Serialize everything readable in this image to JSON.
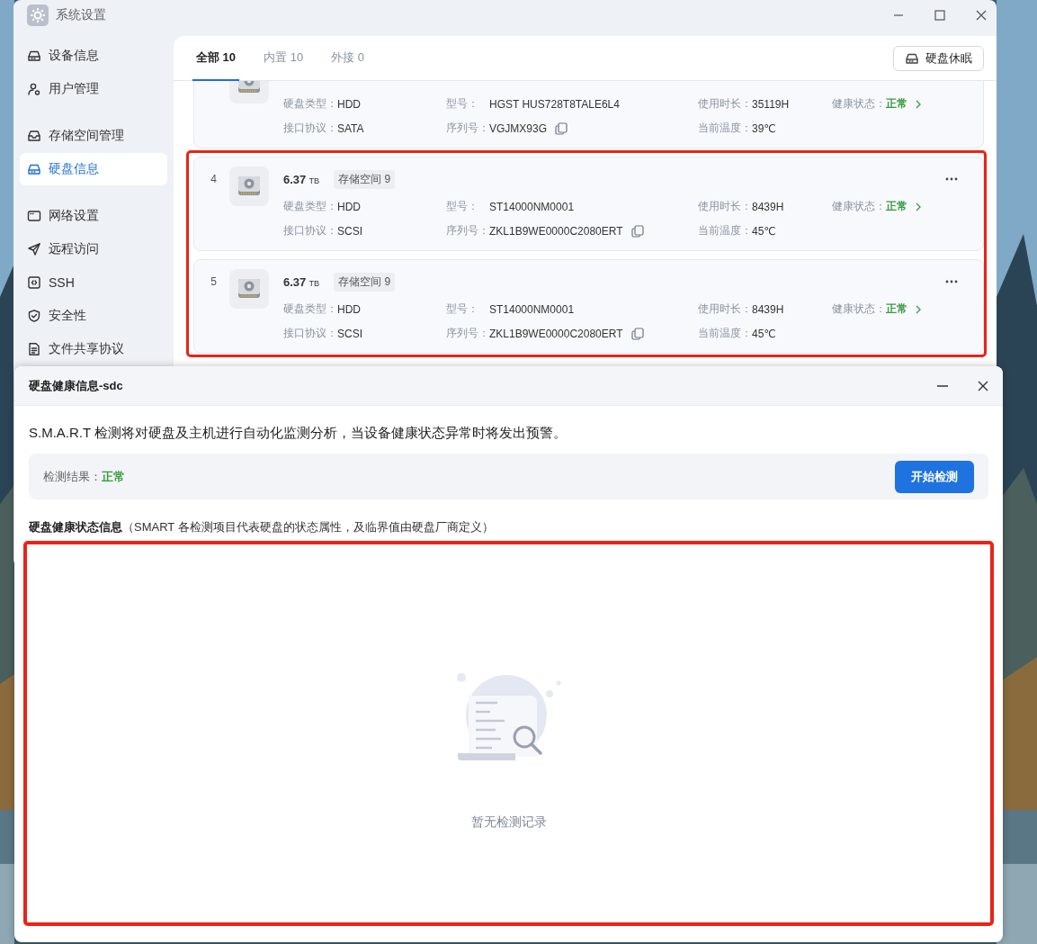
{
  "main_window": {
    "title": "系统设置",
    "sidebar": {
      "groups": [
        {
          "items": [
            {
              "label": "设备信息",
              "selected": false
            },
            {
              "label": "用户管理",
              "selected": false
            }
          ]
        },
        {
          "items": [
            {
              "label": "存储空间管理",
              "selected": false
            },
            {
              "label": "硬盘信息",
              "selected": true
            }
          ]
        },
        {
          "items": [
            {
              "label": "网络设置",
              "selected": false
            },
            {
              "label": "远程访问",
              "selected": false
            },
            {
              "label": "SSH",
              "selected": false
            },
            {
              "label": "安全性",
              "selected": false
            },
            {
              "label": "文件共享协议",
              "selected": false
            }
          ]
        }
      ]
    },
    "tabs": [
      {
        "label": "全部 10",
        "selected": true
      },
      {
        "label": "内置 10",
        "selected": false
      },
      {
        "label": "外接 0",
        "selected": false
      }
    ],
    "sleep_button": "硬盘休眠",
    "disks": [
      {
        "highlighted": false,
        "fields": [
          {
            "kind": "text",
            "label": "硬盘类型：",
            "value": "HDD"
          },
          {
            "kind": "text",
            "label": "接口协议：",
            "value": "SATA"
          },
          {
            "kind": "text",
            "label": "型号：",
            "value": "HGST HUS728T8TALE6L4"
          },
          {
            "kind": "copy",
            "label": "序列号：",
            "value": "VGJMX93G"
          },
          {
            "kind": "text",
            "label": "使用时长：",
            "value": "35119H"
          },
          {
            "kind": "text",
            "label": "当前温度：",
            "value": "39℃"
          },
          {
            "kind": "status",
            "label": "健康状态：",
            "value": "正常",
            "color": "#3a9a40"
          }
        ]
      },
      {
        "index": "4",
        "size": "6.37",
        "unit": "TB",
        "pool": "存储空间 9",
        "menu": true,
        "highlighted": true,
        "fields": [
          {
            "kind": "text",
            "label": "硬盘类型：",
            "value": "HDD"
          },
          {
            "kind": "text",
            "label": "接口协议：",
            "value": "SCSI"
          },
          {
            "kind": "text",
            "label": "型号：",
            "value": "ST14000NM0001"
          },
          {
            "kind": "copy",
            "label": "序列号：",
            "value": "ZKL1B9WE0000C2080ERT"
          },
          {
            "kind": "text",
            "label": "使用时长：",
            "value": "8439H"
          },
          {
            "kind": "text",
            "label": "当前温度：",
            "value": "45℃"
          },
          {
            "kind": "status",
            "label": "健康状态：",
            "value": "正常",
            "color": "#3a9a40"
          }
        ]
      },
      {
        "index": "5",
        "size": "6.37",
        "unit": "TB",
        "pool": "存储空间 9",
        "menu": true,
        "highlighted": true,
        "fields": [
          {
            "kind": "text",
            "label": "硬盘类型：",
            "value": "HDD"
          },
          {
            "kind": "text",
            "label": "接口协议：",
            "value": "SCSI"
          },
          {
            "kind": "text",
            "label": "型号：",
            "value": "ST14000NM0001"
          },
          {
            "kind": "copy",
            "label": "序列号：",
            "value": "ZKL1B9WE0000C2080ERT"
          },
          {
            "kind": "text",
            "label": "使用时长：",
            "value": "8439H"
          },
          {
            "kind": "text",
            "label": "当前温度：",
            "value": "45℃"
          },
          {
            "kind": "status",
            "label": "健康状态：",
            "value": "正常",
            "color": "#3a9a40"
          }
        ]
      }
    ]
  },
  "dialog": {
    "title": "硬盘健康信息-sdc",
    "description": "S.M.A.R.T 检测将对硬盘及主机进行自动化监测分析，当设备健康状态异常时将发出预警。",
    "result": {
      "label": "检测结果：",
      "value": "正常",
      "color": "#3a9a40"
    },
    "start_button": "开始检测",
    "section_heading": "**硬盘健康状态信息**（SMART 各检测项目代表硬盘的状态属性，及临界值由硬盘厂商定义）",
    "empty_state": {
      "text": "暂无检测记录",
      "highlighted": true
    }
  }
}
